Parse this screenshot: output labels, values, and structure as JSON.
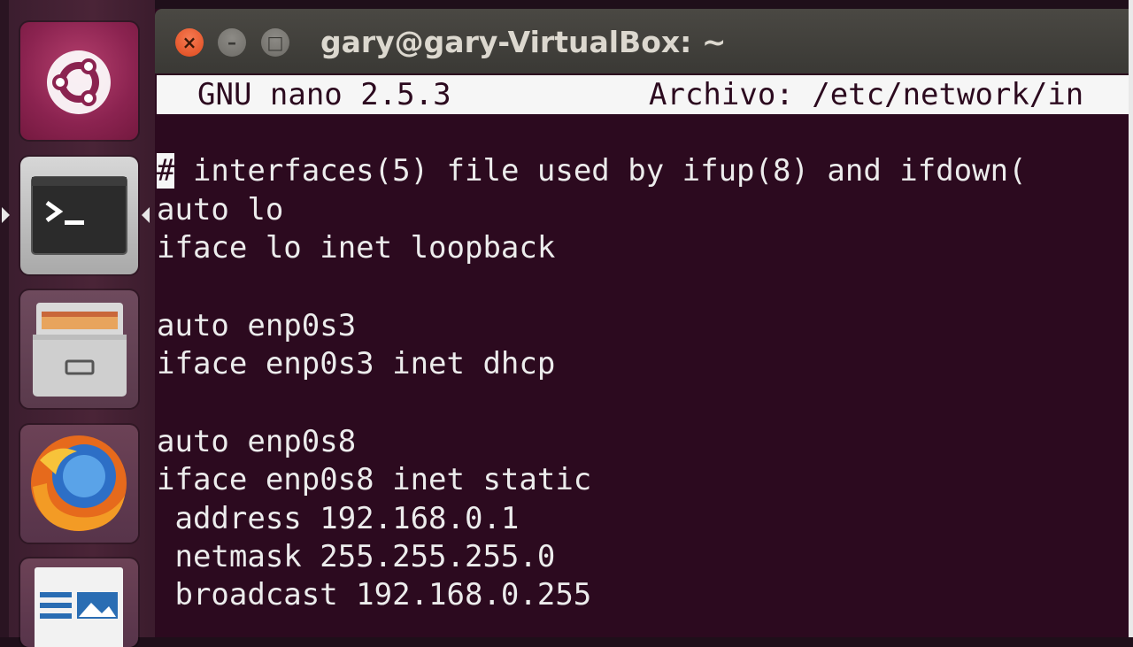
{
  "window": {
    "title": "gary@gary-VirtualBox: ~",
    "controls": {
      "close": "×",
      "minimize": "–",
      "maximize": "□"
    }
  },
  "launcher": {
    "items": [
      "ubuntu-dash-icon",
      "terminal-icon",
      "files-icon",
      "firefox-icon",
      "libreoffice-writer-icon"
    ]
  },
  "nano": {
    "version_label": "GNU nano 2.5.3",
    "file_label": "Archivo: /etc/network/in"
  },
  "file": {
    "line0_cursor": "#",
    "line0_rest": " interfaces(5) file used by ifup(8) and ifdown(",
    "lines": [
      "auto lo",
      "iface lo inet loopback",
      "",
      "auto enp0s3",
      "iface enp0s3 inet dhcp",
      "",
      "auto enp0s8",
      "iface enp0s8 inet static",
      " address 192.168.0.1",
      " netmask 255.255.255.0",
      " broadcast 192.168.0.255"
    ]
  },
  "colors": {
    "terminal_bg": "#2c0a1f",
    "terminal_fg": "#ececec",
    "close_button": "#df4a1d"
  }
}
